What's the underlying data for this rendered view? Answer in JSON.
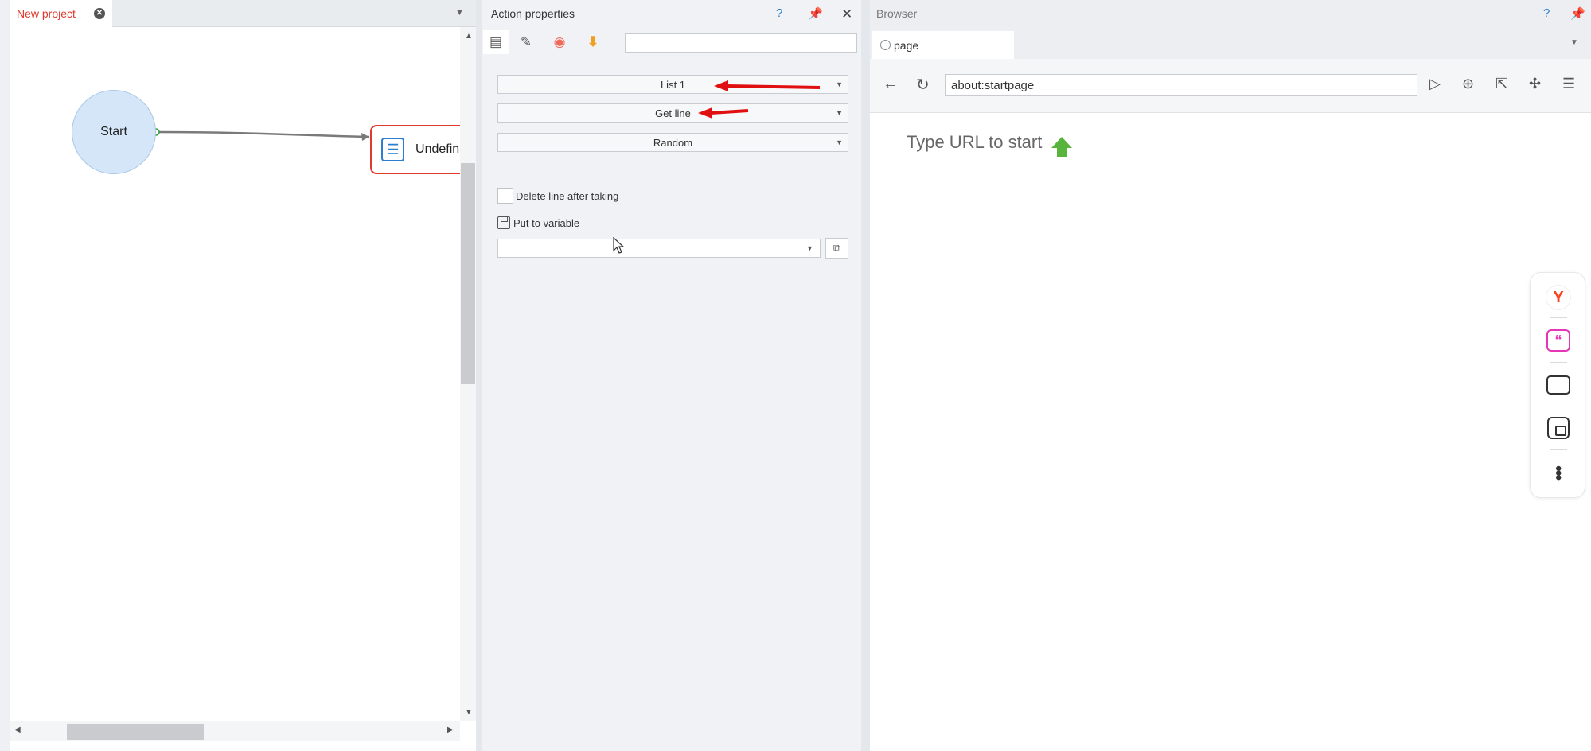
{
  "project": {
    "tab_label": "New project",
    "start_label": "Start",
    "action_label": "Undefined"
  },
  "properties": {
    "title": "Action properties",
    "help": "?",
    "list_select": "List 1",
    "operation_select": "Get line",
    "mode_select": "Random",
    "delete_line_label": "Delete line after taking",
    "put_to_variable_label": "Put to variable",
    "search_value": "",
    "variable_value": ""
  },
  "browser": {
    "title": "Browser",
    "help": "?",
    "tab_label": "page",
    "url": "about:startpage",
    "start_hint": "Type URL to start"
  },
  "colors": {
    "accent_red": "#e03a2e",
    "node_blue": "#d4e6f7",
    "yandex_red": "#fc3f1d",
    "quote_pink": "#e636b5",
    "upload_green": "#58b43a"
  }
}
